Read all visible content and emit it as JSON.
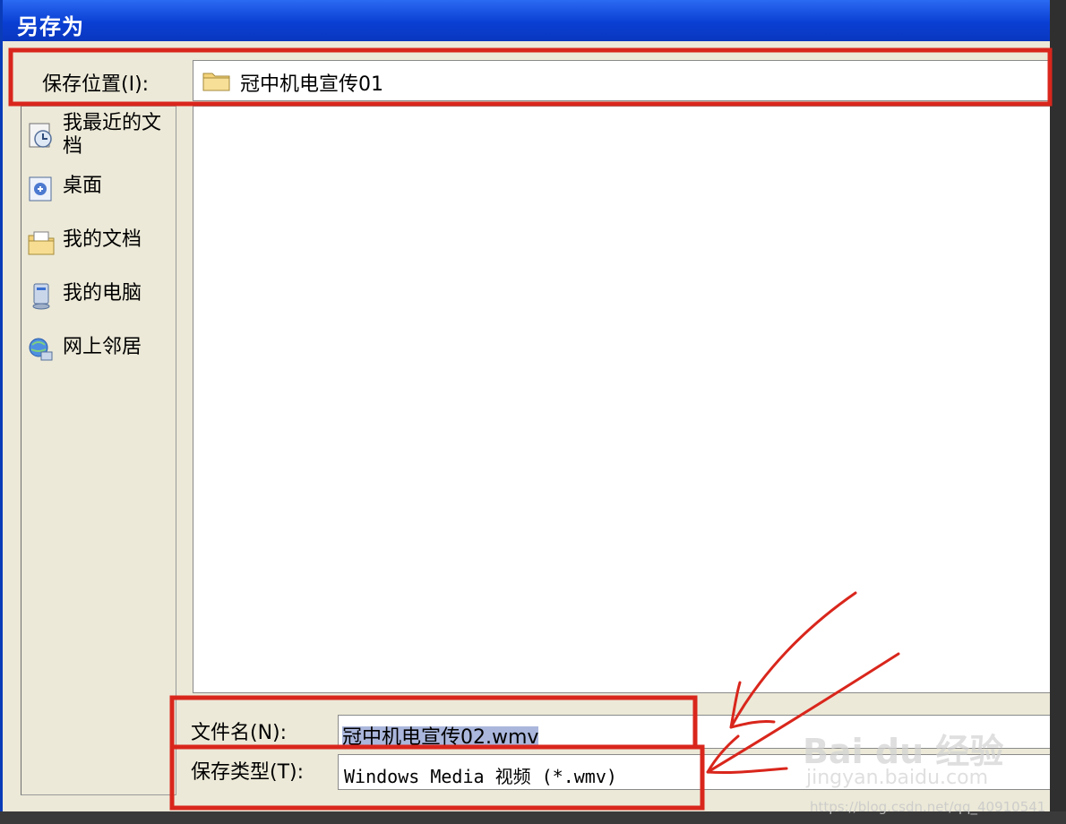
{
  "window": {
    "title": "另存为"
  },
  "lookin": {
    "label": "保存位置(I):",
    "value": "冠中机电宣传01"
  },
  "places": [
    {
      "label": "我最近的文档",
      "icon": "recent-documents-icon"
    },
    {
      "label": "桌面",
      "icon": "desktop-icon"
    },
    {
      "label": "我的文档",
      "icon": "my-documents-icon"
    },
    {
      "label": "我的电脑",
      "icon": "my-computer-icon"
    },
    {
      "label": "网上邻居",
      "icon": "network-places-icon"
    }
  ],
  "filename": {
    "label": "文件名(N):",
    "value": "冠中机电宣传02.wmv"
  },
  "filetype": {
    "label": "保存类型(T):",
    "value": "Windows Media 视频 (*.wmv)"
  },
  "watermark": {
    "brand": "Bai du 经验",
    "domain": "jingyan.baidu.com",
    "url": "https://blog.csdn.net/qq_40910541"
  },
  "colors": {
    "titlebar": "#0a3fd3",
    "annotation": "#d9261c",
    "dialog": "#ece9d8"
  }
}
